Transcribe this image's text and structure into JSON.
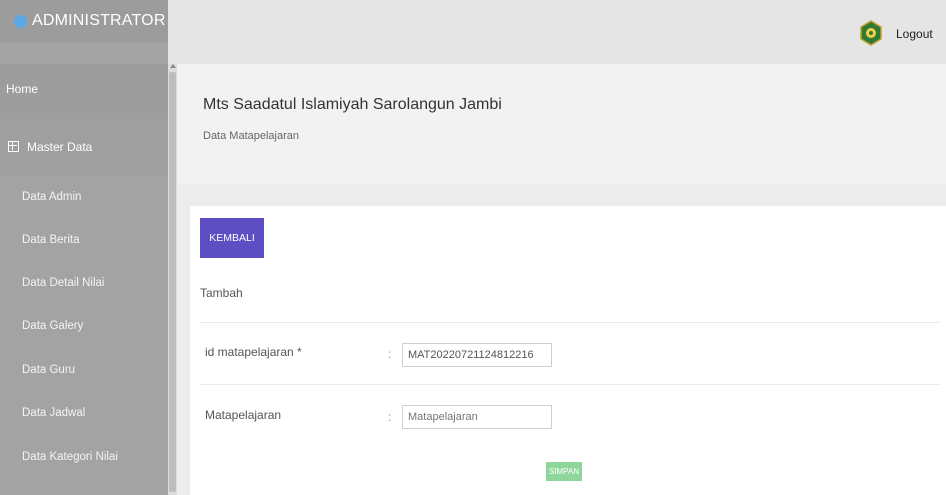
{
  "sidebar": {
    "brand": "ADMINISTRATOR",
    "home": "Home",
    "master": "Master Data",
    "items": [
      {
        "label": "Data Admin"
      },
      {
        "label": "Data Berita"
      },
      {
        "label": "Data Detail Nilai"
      },
      {
        "label": "Data Galery"
      },
      {
        "label": "Data Guru"
      },
      {
        "label": "Data Jadwal"
      },
      {
        "label": "Data Kategori Nilai"
      }
    ]
  },
  "topbar": {
    "logout": "Logout",
    "logo_icon": "school-emblem-icon"
  },
  "header": {
    "title": "Mts Saadatul Islamiyah Sarolangun Jambi",
    "subtitle": "Data Matapelajaran"
  },
  "form": {
    "back_label": "KEMBALI",
    "section": "Tambah",
    "fields": [
      {
        "label": "id matapelajaran *",
        "colon": ":",
        "value": "MAT20220721124812216",
        "placeholder": ""
      },
      {
        "label": "Matapelajaran",
        "colon": ":",
        "value": "",
        "placeholder": "Matapelajaran"
      }
    ],
    "submit_label": "SIMPAN"
  },
  "colors": {
    "accent": "#5d4ec3",
    "success": "#8fd69a",
    "sidebar": "#a3a3a3"
  }
}
